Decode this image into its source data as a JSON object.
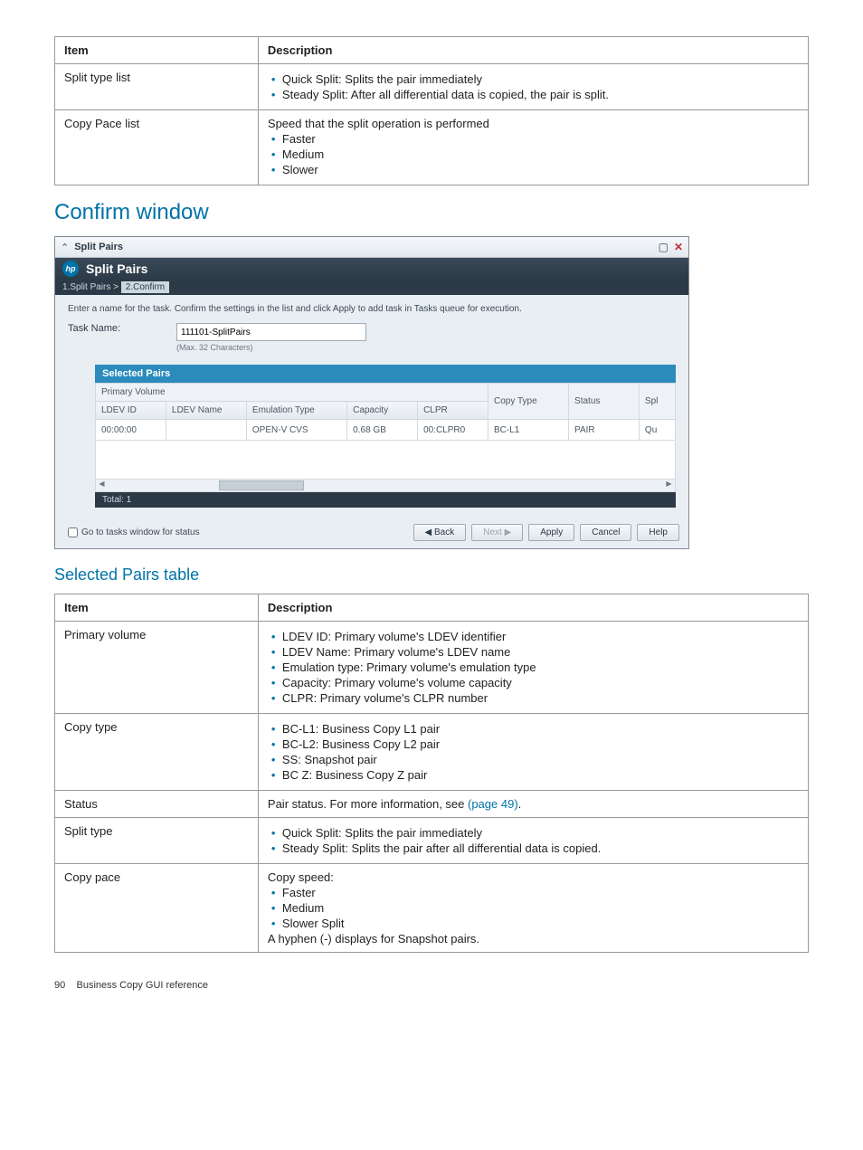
{
  "table1": {
    "head_item": "Item",
    "head_desc": "Description",
    "rows": [
      {
        "item": "Split type list",
        "bullets": [
          "Quick Split: Splits the pair immediately",
          "Steady Split: After all differential data is copied, the pair is split."
        ]
      },
      {
        "item": "Copy Pace list",
        "lead": "Speed that the split operation is performed",
        "bullets": [
          "Faster",
          "Medium",
          "Slower"
        ]
      }
    ]
  },
  "confirm_heading": "Confirm window",
  "dlg": {
    "titlebar": "Split Pairs",
    "header": "Split Pairs",
    "crumb1": "1.Split Pairs  >",
    "crumb2": "2.Confirm",
    "hint": "Enter a name for the task. Confirm the settings in the list and click Apply to add task in Tasks queue for execution.",
    "task_name_label": "Task Name:",
    "task_name_value": "111101-SplitPairs",
    "task_name_sub": "(Max. 32 Characters)",
    "sel_pairs": "Selected Pairs",
    "group_pv": "Primary Volume",
    "cols": {
      "ldev_id": "LDEV ID",
      "ldev_name": "LDEV Name",
      "emu": "Emulation Type",
      "cap": "Capacity",
      "clpr": "CLPR",
      "copy_type": "Copy Type",
      "status": "Status",
      "spl": "Spl"
    },
    "row": {
      "ldev_id": "00:00:00",
      "ldev_name": "",
      "emu": "OPEN-V CVS",
      "cap": "0.68 GB",
      "clpr": "00:CLPR0",
      "copy_type": "BC-L1",
      "status": "PAIR",
      "spl": "Qu"
    },
    "total": "Total: 1",
    "go_tasks": "Go to tasks window for status",
    "btn_back": "◀ Back",
    "btn_next": "Next ▶",
    "btn_apply": "Apply",
    "btn_cancel": "Cancel",
    "btn_help": "Help"
  },
  "selected_heading": "Selected Pairs table",
  "table2": {
    "head_item": "Item",
    "head_desc": "Description",
    "primary": {
      "item": "Primary volume",
      "bullets": [
        "LDEV ID: Primary volume's LDEV identifier",
        "LDEV Name: Primary volume's LDEV name",
        "Emulation type: Primary volume's emulation type",
        "Capacity: Primary volume's volume capacity",
        "CLPR: Primary volume's CLPR number"
      ]
    },
    "copytype": {
      "item": "Copy type",
      "bullets": [
        "BC-L1: Business Copy L1 pair",
        "BC-L2: Business Copy L2 pair",
        "SS: Snapshot pair",
        "BC Z: Business Copy Z pair"
      ]
    },
    "status": {
      "item": "Status",
      "text_pre": "Pair status. For more information, see ",
      "link": "(page 49)",
      "text_post": "."
    },
    "splittype": {
      "item": "Split type",
      "bullets": [
        "Quick Split: Splits the pair immediately",
        "Steady Split: Splits the pair after all differential data is copied."
      ]
    },
    "copypace": {
      "item": "Copy pace",
      "lead": "Copy speed:",
      "bullets": [
        "Faster",
        "Medium",
        "Slower Split"
      ],
      "tail": "A hyphen (-) displays for Snapshot pairs."
    }
  },
  "footer": {
    "pagenum": "90",
    "text": "Business Copy GUI reference"
  }
}
